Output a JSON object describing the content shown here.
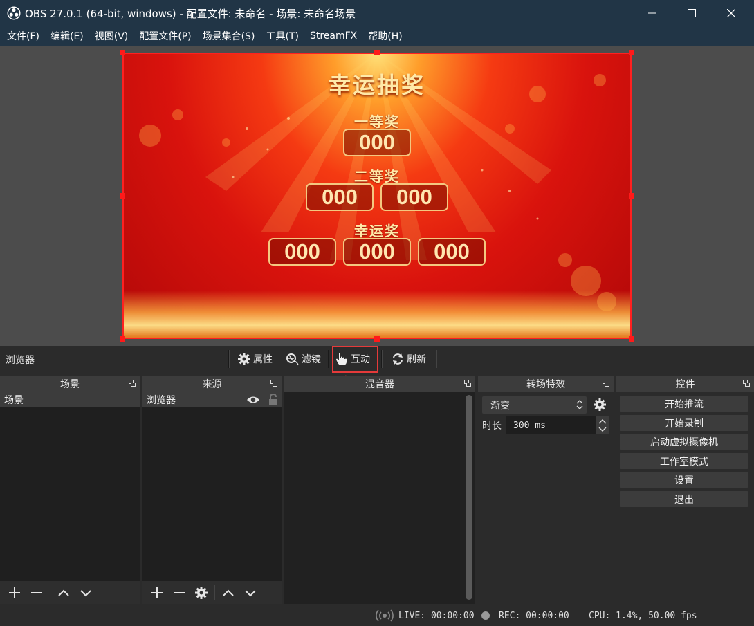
{
  "window": {
    "title": "OBS 27.0.1 (64-bit, windows) - 配置文件: 未命名 - 场景: 未命名场景",
    "minimize_icon": "minimize-icon",
    "maximize_icon": "maximize-icon",
    "close_icon": "close-icon"
  },
  "menu": [
    "文件(F)",
    "编辑(E)",
    "视图(V)",
    "配置文件(P)",
    "场景集合(S)",
    "工具(T)",
    "StreamFX",
    "帮助(H)"
  ],
  "preview": {
    "title": "幸运抽奖",
    "prizes": [
      {
        "label": "一等奖",
        "values": [
          "000"
        ]
      },
      {
        "label": "二等奖",
        "values": [
          "000",
          "000"
        ]
      },
      {
        "label": "幸运奖",
        "values": [
          "000",
          "000",
          "000"
        ]
      }
    ],
    "colors": {
      "background": "#d9130d",
      "text": "#ffe9a8",
      "selection": "#ff2020"
    }
  },
  "source_toolbar": {
    "selected_source": "浏览器",
    "properties": "属性",
    "filters": "滤镜",
    "interact": "互动",
    "refresh": "刷新"
  },
  "scenes": {
    "header": "场景",
    "items": [
      "场景"
    ]
  },
  "sources": {
    "header": "来源",
    "items": [
      "浏览器"
    ]
  },
  "mixer": {
    "header": "混音器"
  },
  "transitions": {
    "header": "转场特效",
    "selected": "渐变",
    "duration_label": "时长",
    "duration_value": "300 ms"
  },
  "controls": {
    "header": "控件",
    "buttons": [
      "开始推流",
      "开始录制",
      "启动虚拟摄像机",
      "工作室模式",
      "设置",
      "退出"
    ]
  },
  "status": {
    "live": "LIVE: 00:00:00",
    "rec": "REC: 00:00:00",
    "cpu": "CPU: 1.4%, 50.00 fps"
  },
  "annotation": {
    "highlight_color": "#e53a3a"
  }
}
